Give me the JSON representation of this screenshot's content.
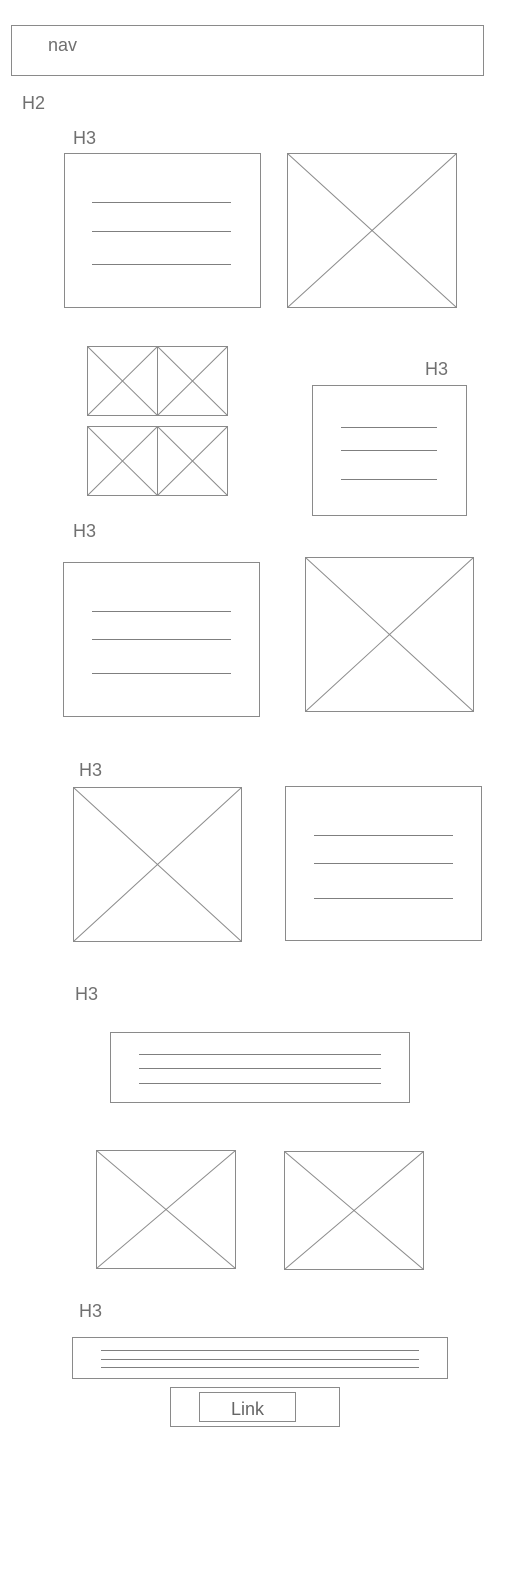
{
  "nav": {
    "label": "nav"
  },
  "page": {
    "h2": "H2"
  },
  "sections": {
    "one": {
      "heading": "H3"
    },
    "two": {
      "heading": "H3"
    },
    "three": {
      "heading": "H3"
    },
    "four": {
      "heading": "H3"
    },
    "five": {
      "heading": "H3"
    },
    "six": {
      "heading": "H3"
    }
  },
  "footer": {
    "link_label": "Link"
  }
}
